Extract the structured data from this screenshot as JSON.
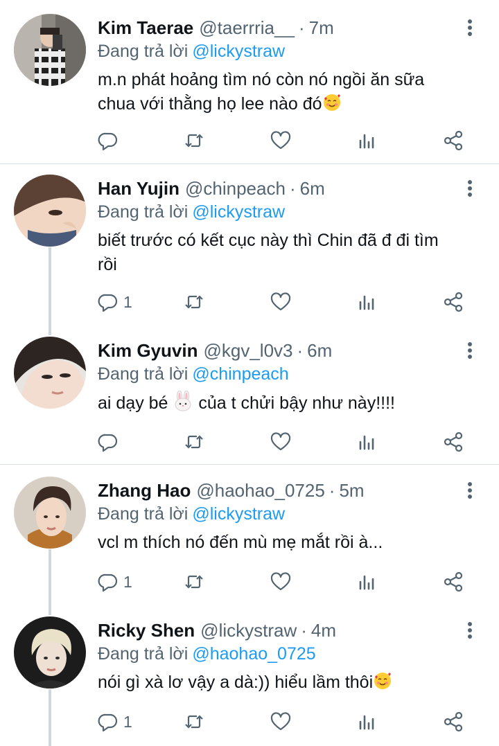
{
  "reply_prefix": "Đang trả lời",
  "tweets": [
    {
      "name": "Kim Taerae",
      "handle": "@taerrria__",
      "time": "7m",
      "reply_to": "@lickystraw",
      "text_line1": "m.n phát hoảng tìm nó còn nó ngồi ăn sữa",
      "text_line2": "chua với thằng họ lee nào đó",
      "emoji": "smiling-face-with-hearts",
      "reply_count": ""
    },
    {
      "name": "Han Yujin",
      "handle": "@chinpeach",
      "time": "6m",
      "reply_to": "@lickystraw",
      "text_line1": "biết trước có kết cục này thì Chin đã đ đi tìm",
      "text_line2": "rồi",
      "reply_count": "1"
    },
    {
      "name": "Kim Gyuvin",
      "handle": "@kgv_l0v3",
      "time": "6m",
      "reply_to": "@chinpeach",
      "text_before": "ai dạy bé",
      "emoji": "rabbit-face",
      "text_after": "của t chửi bậy như này!!!!",
      "reply_count": ""
    },
    {
      "name": "Zhang Hao",
      "handle": "@haohao_0725",
      "time": "5m",
      "reply_to": "@lickystraw",
      "text_line1": "vcl m thích nó đến mù mẹ mắt rồi à...",
      "reply_count": "1"
    },
    {
      "name": "Ricky Shen",
      "handle": "@lickystraw",
      "time": "4m",
      "reply_to": "@haohao_0725",
      "text_line1": "nói gì xà lơ vậy a dà:)) hiểu lầm thôi",
      "emoji": "smiling-face-with-hearts",
      "reply_count": "1"
    }
  ],
  "colors": {
    "text": "#0f1419",
    "secondary": "#536471",
    "link": "#1d9bf0",
    "icon": "#536471",
    "thread_line": "#cfd9de"
  }
}
